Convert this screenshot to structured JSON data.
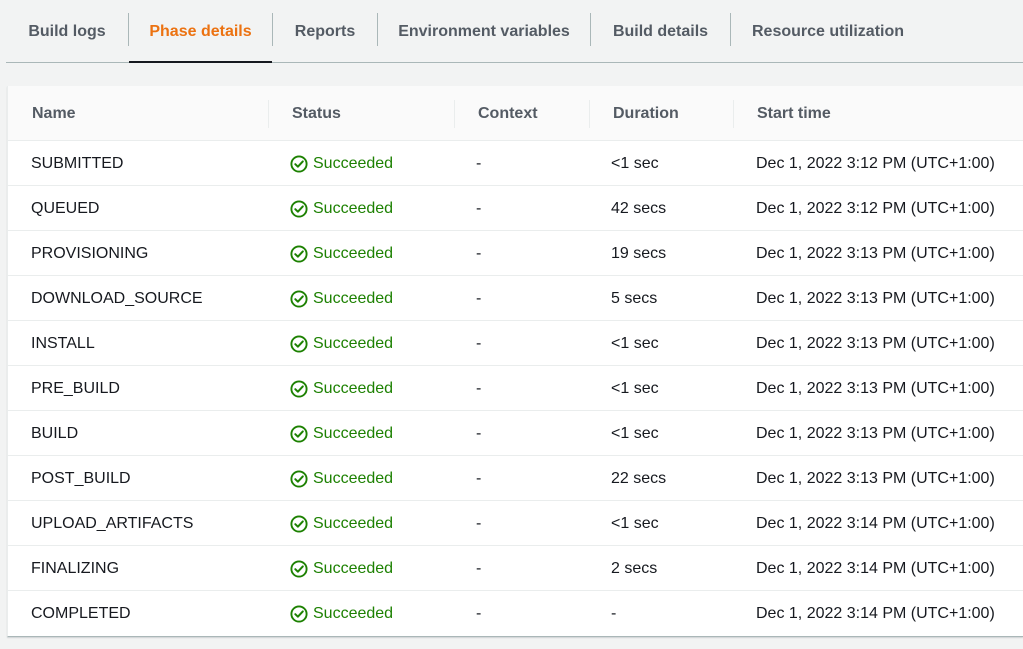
{
  "tabs": [
    {
      "label": "Build logs",
      "active": false
    },
    {
      "label": "Phase details",
      "active": true
    },
    {
      "label": "Reports",
      "active": false
    },
    {
      "label": "Environment variables",
      "active": false
    },
    {
      "label": "Build details",
      "active": false
    },
    {
      "label": "Resource utilization",
      "active": false
    }
  ],
  "table": {
    "columns": [
      "Name",
      "Status",
      "Context",
      "Duration",
      "Start time"
    ],
    "rows": [
      {
        "name": "SUBMITTED",
        "status": "Succeeded",
        "context": "-",
        "duration": "<1 sec",
        "start": "Dec 1, 2022 3:12 PM (UTC+1:00)"
      },
      {
        "name": "QUEUED",
        "status": "Succeeded",
        "context": "-",
        "duration": "42 secs",
        "start": "Dec 1, 2022 3:12 PM (UTC+1:00)"
      },
      {
        "name": "PROVISIONING",
        "status": "Succeeded",
        "context": "-",
        "duration": "19 secs",
        "start": "Dec 1, 2022 3:13 PM (UTC+1:00)"
      },
      {
        "name": "DOWNLOAD_SOURCE",
        "status": "Succeeded",
        "context": "-",
        "duration": "5 secs",
        "start": "Dec 1, 2022 3:13 PM (UTC+1:00)"
      },
      {
        "name": "INSTALL",
        "status": "Succeeded",
        "context": "-",
        "duration": "<1 sec",
        "start": "Dec 1, 2022 3:13 PM (UTC+1:00)"
      },
      {
        "name": "PRE_BUILD",
        "status": "Succeeded",
        "context": "-",
        "duration": "<1 sec",
        "start": "Dec 1, 2022 3:13 PM (UTC+1:00)"
      },
      {
        "name": "BUILD",
        "status": "Succeeded",
        "context": "-",
        "duration": "<1 sec",
        "start": "Dec 1, 2022 3:13 PM (UTC+1:00)"
      },
      {
        "name": "POST_BUILD",
        "status": "Succeeded",
        "context": "-",
        "duration": "22 secs",
        "start": "Dec 1, 2022 3:13 PM (UTC+1:00)"
      },
      {
        "name": "UPLOAD_ARTIFACTS",
        "status": "Succeeded",
        "context": "-",
        "duration": "<1 sec",
        "start": "Dec 1, 2022 3:14 PM (UTC+1:00)"
      },
      {
        "name": "FINALIZING",
        "status": "Succeeded",
        "context": "-",
        "duration": "2 secs",
        "start": "Dec 1, 2022 3:14 PM (UTC+1:00)"
      },
      {
        "name": "COMPLETED",
        "status": "Succeeded",
        "context": "-",
        "duration": "-",
        "start": "Dec 1, 2022 3:14 PM (UTC+1:00)"
      }
    ]
  },
  "icons": {
    "status": "check-circle-icon"
  },
  "colors": {
    "accent": "#ec7211",
    "success": "#1d8102",
    "text": "#16191f",
    "muted": "#545b64"
  }
}
